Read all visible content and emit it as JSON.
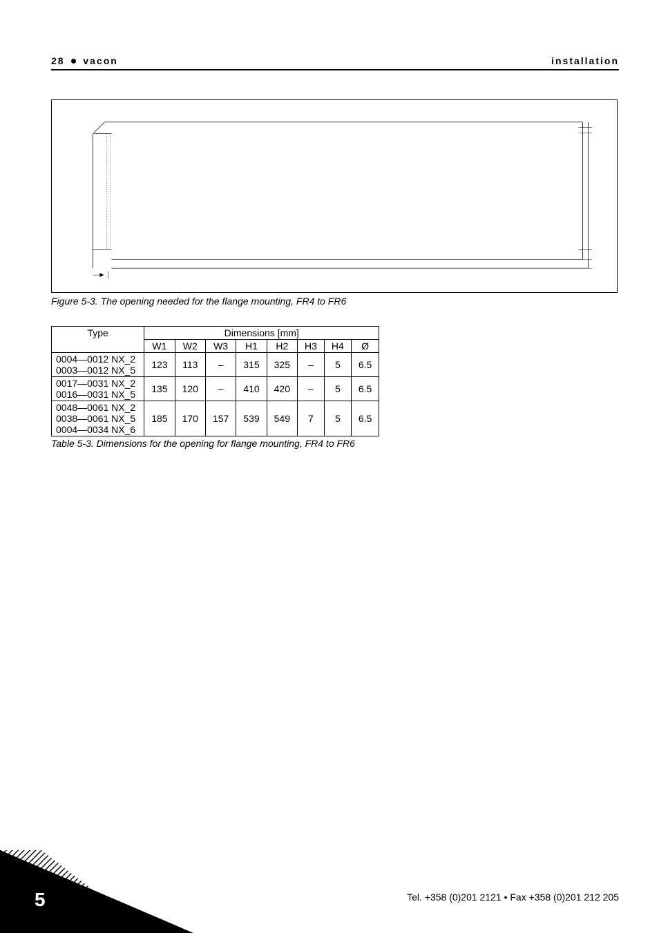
{
  "header": {
    "page_num": "28",
    "brand": "vacon",
    "section": "installation"
  },
  "figure": {
    "caption": "Figure 5-3. The opening needed for the flange mounting, FR4 to FR6"
  },
  "chart_data": {
    "type": "table",
    "title": "Dimensions for the opening for flange mounting, FR4 to FR6",
    "header_cells": {
      "type_label": "Type",
      "dimensions_label": "Dimensions [mm]"
    },
    "columns": [
      "W1",
      "W2",
      "W3",
      "H1",
      "H2",
      "H3",
      "H4",
      "Ø"
    ],
    "rows": [
      {
        "type_lines": [
          "0004—0012 NX_2",
          "0003—0012 NX_5"
        ],
        "values": [
          "123",
          "113",
          "–",
          "315",
          "325",
          "–",
          "5",
          "6.5"
        ]
      },
      {
        "type_lines": [
          "0017—0031 NX_2",
          "0016—0031 NX_5"
        ],
        "values": [
          "135",
          "120",
          "–",
          "410",
          "420",
          "–",
          "5",
          "6.5"
        ]
      },
      {
        "type_lines": [
          "0048—0061 NX_2",
          "0038—0061 NX_5",
          "0004—0034 NX_6"
        ],
        "values": [
          "185",
          "170",
          "157",
          "539",
          "549",
          "7",
          "5",
          "6.5"
        ]
      }
    ]
  },
  "table_caption": "Table 5-3. Dimensions for the opening for flange mounting, FR4 to FR6",
  "footer": {
    "chapter": "5",
    "contact": "Tel. +358 (0)201 2121 • Fax +358 (0)201 212 205"
  }
}
